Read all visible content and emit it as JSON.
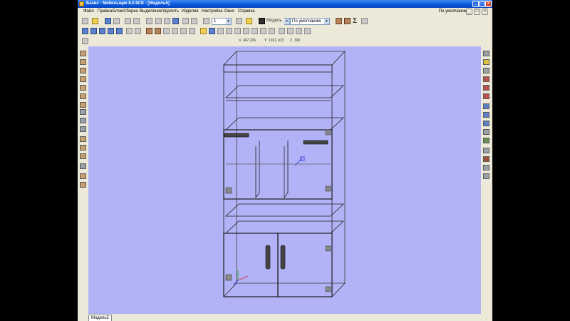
{
  "window": {
    "title": "Базис - Мебельщик 8.0.9CE - [Модель5]"
  },
  "menu": [
    "Файл",
    "Правка",
    "Блок/Сборка",
    "Выделение",
    "Удалить",
    "Изделие",
    "Настройка",
    "Окно",
    "Справка"
  ],
  "menu_right_combo": "По умолчанию",
  "toolbar": {
    "layer_value": "1",
    "color_label": "Модель",
    "material_value": "По умолчанию"
  },
  "coords": {
    "x": "467,206",
    "y": "1021,103",
    "z": "300"
  },
  "coord_labels": {
    "x": "X",
    "y": "Y",
    "z": "Z"
  },
  "status": {
    "tab": "Модель5"
  },
  "colors": {
    "viewport": "#b2b3f7",
    "titlebar": "#0a56d8",
    "chrome": "#ece9d8"
  }
}
